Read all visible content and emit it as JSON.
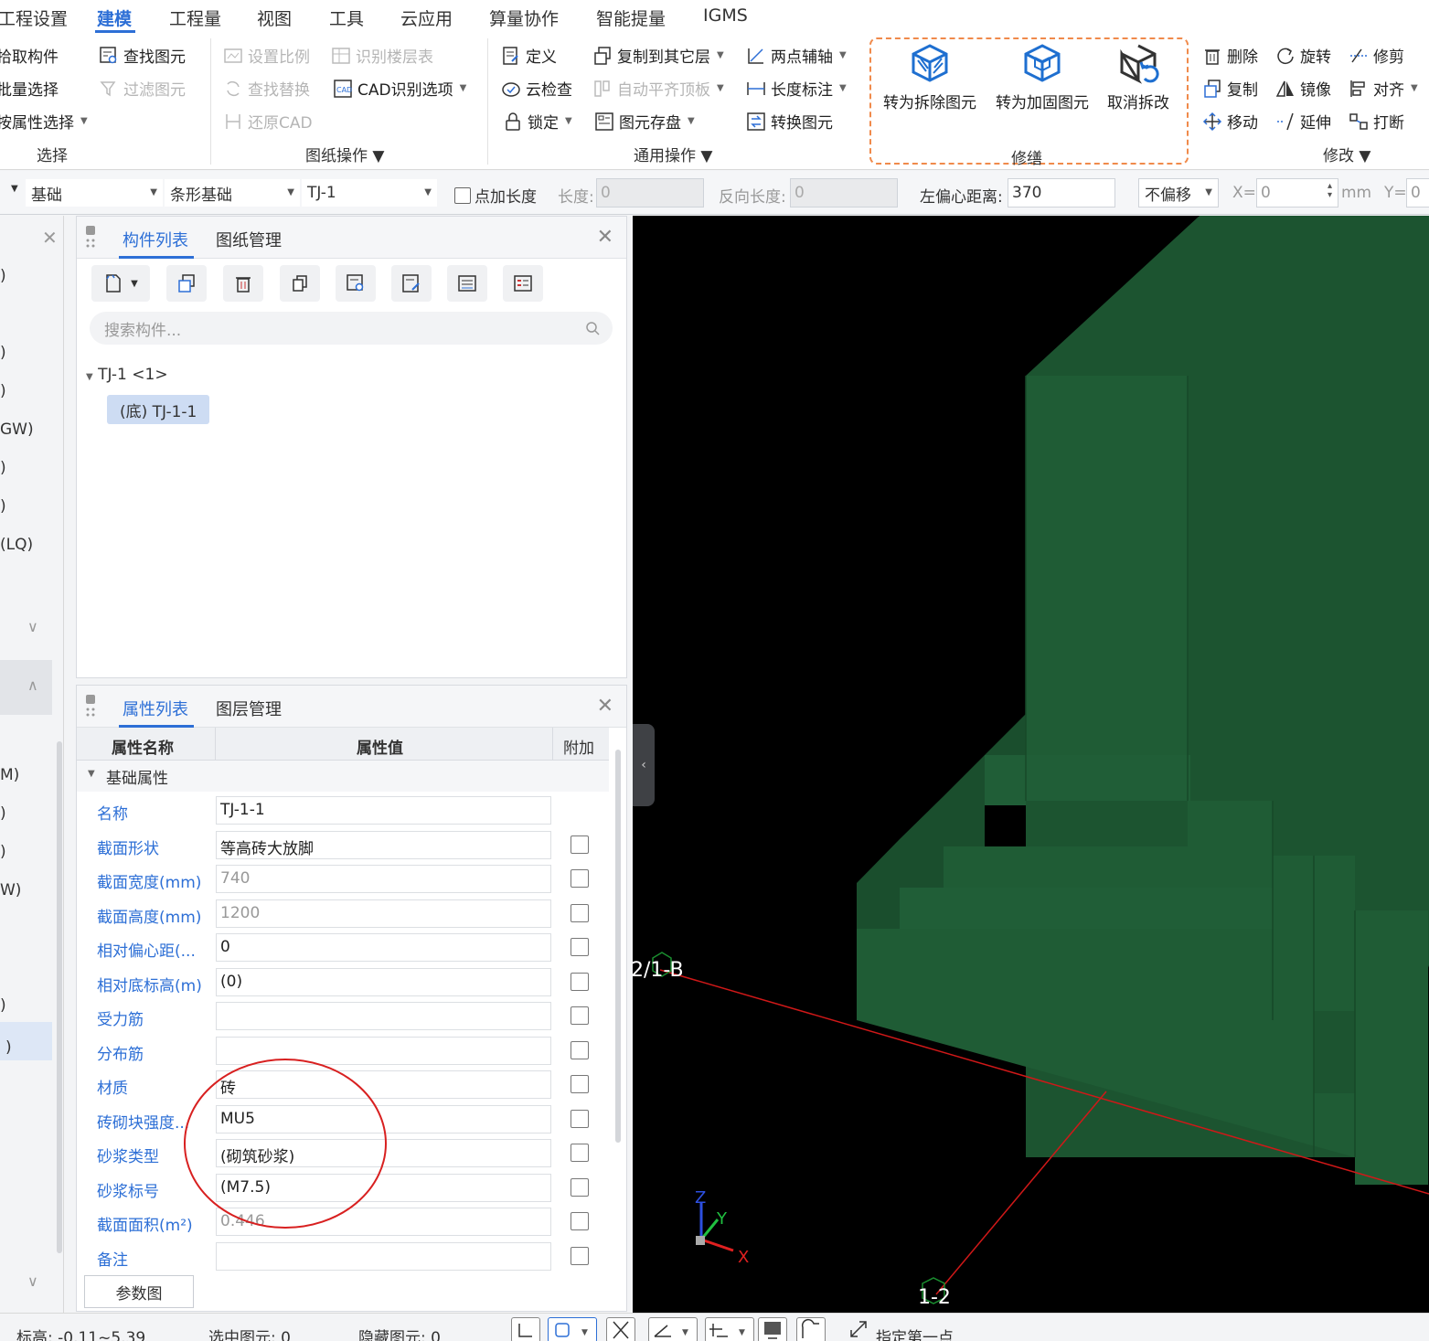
{
  "menu": {
    "items": [
      "工程设置",
      "建模",
      "工程量",
      "视图",
      "工具",
      "云应用",
      "算量协作",
      "智能提量",
      "IGMS"
    ],
    "active": "建模"
  },
  "ribbon": {
    "select_group": {
      "label": "选择",
      "pick": "拾取构件",
      "batch": "批量选择",
      "by_attr": "按属性选择",
      "find": "查找图元",
      "filter": "过滤图元"
    },
    "drawing_group": {
      "label": "图纸操作",
      "set_scale": "设置比例",
      "identify_floors": "识别楼层表",
      "find_replace": "查找替换",
      "cad_options": "CAD识别选项",
      "restore_cad": "还原CAD"
    },
    "common_group": {
      "label": "通用操作",
      "define": "定义",
      "copy_to_layer": "复制到其它层",
      "two_point_axis": "两点辅轴",
      "cloud_check": "云检查",
      "auto_align_slab": "自动平齐顶板",
      "dim_length": "长度标注",
      "lock": "锁定",
      "save_element": "图元存盘",
      "convert_element": "转换图元"
    },
    "repair_group": {
      "label": "修缮",
      "to_demolish": "转为拆除图元",
      "to_reinforce": "转为加固图元",
      "cancel_repair": "取消拆改"
    },
    "modify_group": {
      "label": "修改",
      "delete": "删除",
      "rotate": "旋转",
      "trim": "修剪",
      "copy": "复制",
      "mirror": "镜像",
      "align": "对齐",
      "move": "移动",
      "extend": "延伸",
      "break": "打断"
    }
  },
  "prop_toolbar": {
    "category": "基础",
    "type": "条形基础",
    "component": "TJ-1",
    "point_length_label": "点加长度",
    "length_label": "长度:",
    "length_value": "0",
    "reverse_length_label": "反向长度:",
    "reverse_length_value": "0",
    "left_offset_label": "左偏心距离:",
    "left_offset_value": "370",
    "offset_mode": "不偏移",
    "x_label": "X=",
    "x_value": "0",
    "unit": "mm",
    "y_label": "Y=",
    "y_value": "0"
  },
  "left_nav": {
    "fragments": [
      ")",
      ")",
      ")",
      "GW)",
      ")",
      ")",
      "(LQ)",
      "M)",
      ")",
      ")",
      "W)",
      ")",
      ")"
    ]
  },
  "component_panel": {
    "tabs": [
      "构件列表",
      "图纸管理"
    ],
    "search_placeholder": "搜索构件...",
    "tree_root": "TJ-1 <1>",
    "tree_child": "(底) TJ-1-1"
  },
  "property_panel": {
    "tabs": [
      "属性列表",
      "图层管理"
    ],
    "headers": [
      "属性名称",
      "属性值",
      "附加"
    ],
    "group": "基础属性",
    "rows": [
      {
        "name": "名称",
        "value": "TJ-1-1"
      },
      {
        "name": "截面形状",
        "value": "等高砖大放脚"
      },
      {
        "name": "截面宽度(mm)",
        "value": "740"
      },
      {
        "name": "截面高度(mm)",
        "value": "1200"
      },
      {
        "name": "相对偏心距(...",
        "value": "0"
      },
      {
        "name": "相对底标高(m)",
        "value": "(0)"
      },
      {
        "name": "受力筋",
        "value": ""
      },
      {
        "name": "分布筋",
        "value": ""
      },
      {
        "name": "材质",
        "value": "砖"
      },
      {
        "name": "砖砌块强度...",
        "value": "MU5"
      },
      {
        "name": "砂浆类型",
        "value": "(砌筑砂浆)"
      },
      {
        "name": "砂浆标号",
        "value": "(M7.5)"
      },
      {
        "name": "截面面积(m²)",
        "value": "0.446"
      },
      {
        "name": "备注",
        "value": ""
      }
    ],
    "param_button": "参数图"
  },
  "viewport": {
    "axis_label_b": "2/1-B",
    "axis_label_2": "1-2",
    "x_axis": "X",
    "y_axis": "Y",
    "z_axis": "Z",
    "colors": {
      "solid_front": "#1f5c35",
      "solid_side": "#1c5430",
      "axis_line": "#d01818"
    }
  },
  "status_bar": {
    "elevation": "标高:  -0.11~5.39",
    "selected": "选中图元:  0",
    "hidden": "隐藏图元:  0",
    "prompt": "指定第一点"
  }
}
